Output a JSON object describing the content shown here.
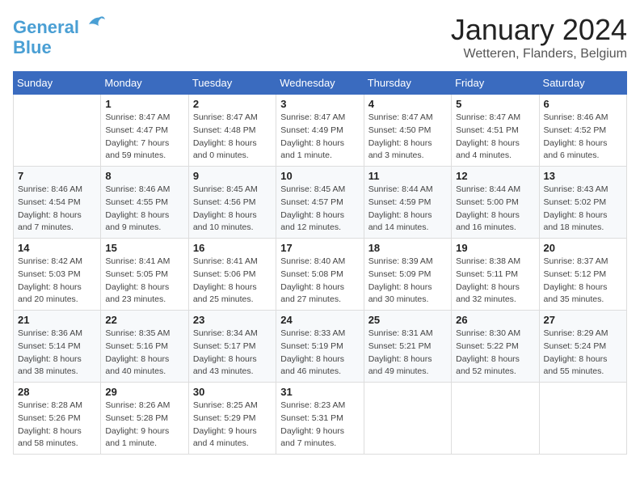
{
  "logo": {
    "line1": "General",
    "line2": "Blue"
  },
  "header": {
    "month": "January 2024",
    "location": "Wetteren, Flanders, Belgium"
  },
  "weekdays": [
    "Sunday",
    "Monday",
    "Tuesday",
    "Wednesday",
    "Thursday",
    "Friday",
    "Saturday"
  ],
  "weeks": [
    [
      {
        "day": "",
        "details": []
      },
      {
        "day": "1",
        "details": [
          "Sunrise: 8:47 AM",
          "Sunset: 4:47 PM",
          "Daylight: 7 hours",
          "and 59 minutes."
        ]
      },
      {
        "day": "2",
        "details": [
          "Sunrise: 8:47 AM",
          "Sunset: 4:48 PM",
          "Daylight: 8 hours",
          "and 0 minutes."
        ]
      },
      {
        "day": "3",
        "details": [
          "Sunrise: 8:47 AM",
          "Sunset: 4:49 PM",
          "Daylight: 8 hours",
          "and 1 minute."
        ]
      },
      {
        "day": "4",
        "details": [
          "Sunrise: 8:47 AM",
          "Sunset: 4:50 PM",
          "Daylight: 8 hours",
          "and 3 minutes."
        ]
      },
      {
        "day": "5",
        "details": [
          "Sunrise: 8:47 AM",
          "Sunset: 4:51 PM",
          "Daylight: 8 hours",
          "and 4 minutes."
        ]
      },
      {
        "day": "6",
        "details": [
          "Sunrise: 8:46 AM",
          "Sunset: 4:52 PM",
          "Daylight: 8 hours",
          "and 6 minutes."
        ]
      }
    ],
    [
      {
        "day": "7",
        "details": [
          "Sunrise: 8:46 AM",
          "Sunset: 4:54 PM",
          "Daylight: 8 hours",
          "and 7 minutes."
        ]
      },
      {
        "day": "8",
        "details": [
          "Sunrise: 8:46 AM",
          "Sunset: 4:55 PM",
          "Daylight: 8 hours",
          "and 9 minutes."
        ]
      },
      {
        "day": "9",
        "details": [
          "Sunrise: 8:45 AM",
          "Sunset: 4:56 PM",
          "Daylight: 8 hours",
          "and 10 minutes."
        ]
      },
      {
        "day": "10",
        "details": [
          "Sunrise: 8:45 AM",
          "Sunset: 4:57 PM",
          "Daylight: 8 hours",
          "and 12 minutes."
        ]
      },
      {
        "day": "11",
        "details": [
          "Sunrise: 8:44 AM",
          "Sunset: 4:59 PM",
          "Daylight: 8 hours",
          "and 14 minutes."
        ]
      },
      {
        "day": "12",
        "details": [
          "Sunrise: 8:44 AM",
          "Sunset: 5:00 PM",
          "Daylight: 8 hours",
          "and 16 minutes."
        ]
      },
      {
        "day": "13",
        "details": [
          "Sunrise: 8:43 AM",
          "Sunset: 5:02 PM",
          "Daylight: 8 hours",
          "and 18 minutes."
        ]
      }
    ],
    [
      {
        "day": "14",
        "details": [
          "Sunrise: 8:42 AM",
          "Sunset: 5:03 PM",
          "Daylight: 8 hours",
          "and 20 minutes."
        ]
      },
      {
        "day": "15",
        "details": [
          "Sunrise: 8:41 AM",
          "Sunset: 5:05 PM",
          "Daylight: 8 hours",
          "and 23 minutes."
        ]
      },
      {
        "day": "16",
        "details": [
          "Sunrise: 8:41 AM",
          "Sunset: 5:06 PM",
          "Daylight: 8 hours",
          "and 25 minutes."
        ]
      },
      {
        "day": "17",
        "details": [
          "Sunrise: 8:40 AM",
          "Sunset: 5:08 PM",
          "Daylight: 8 hours",
          "and 27 minutes."
        ]
      },
      {
        "day": "18",
        "details": [
          "Sunrise: 8:39 AM",
          "Sunset: 5:09 PM",
          "Daylight: 8 hours",
          "and 30 minutes."
        ]
      },
      {
        "day": "19",
        "details": [
          "Sunrise: 8:38 AM",
          "Sunset: 5:11 PM",
          "Daylight: 8 hours",
          "and 32 minutes."
        ]
      },
      {
        "day": "20",
        "details": [
          "Sunrise: 8:37 AM",
          "Sunset: 5:12 PM",
          "Daylight: 8 hours",
          "and 35 minutes."
        ]
      }
    ],
    [
      {
        "day": "21",
        "details": [
          "Sunrise: 8:36 AM",
          "Sunset: 5:14 PM",
          "Daylight: 8 hours",
          "and 38 minutes."
        ]
      },
      {
        "day": "22",
        "details": [
          "Sunrise: 8:35 AM",
          "Sunset: 5:16 PM",
          "Daylight: 8 hours",
          "and 40 minutes."
        ]
      },
      {
        "day": "23",
        "details": [
          "Sunrise: 8:34 AM",
          "Sunset: 5:17 PM",
          "Daylight: 8 hours",
          "and 43 minutes."
        ]
      },
      {
        "day": "24",
        "details": [
          "Sunrise: 8:33 AM",
          "Sunset: 5:19 PM",
          "Daylight: 8 hours",
          "and 46 minutes."
        ]
      },
      {
        "day": "25",
        "details": [
          "Sunrise: 8:31 AM",
          "Sunset: 5:21 PM",
          "Daylight: 8 hours",
          "and 49 minutes."
        ]
      },
      {
        "day": "26",
        "details": [
          "Sunrise: 8:30 AM",
          "Sunset: 5:22 PM",
          "Daylight: 8 hours",
          "and 52 minutes."
        ]
      },
      {
        "day": "27",
        "details": [
          "Sunrise: 8:29 AM",
          "Sunset: 5:24 PM",
          "Daylight: 8 hours",
          "and 55 minutes."
        ]
      }
    ],
    [
      {
        "day": "28",
        "details": [
          "Sunrise: 8:28 AM",
          "Sunset: 5:26 PM",
          "Daylight: 8 hours",
          "and 58 minutes."
        ]
      },
      {
        "day": "29",
        "details": [
          "Sunrise: 8:26 AM",
          "Sunset: 5:28 PM",
          "Daylight: 9 hours",
          "and 1 minute."
        ]
      },
      {
        "day": "30",
        "details": [
          "Sunrise: 8:25 AM",
          "Sunset: 5:29 PM",
          "Daylight: 9 hours",
          "and 4 minutes."
        ]
      },
      {
        "day": "31",
        "details": [
          "Sunrise: 8:23 AM",
          "Sunset: 5:31 PM",
          "Daylight: 9 hours",
          "and 7 minutes."
        ]
      },
      {
        "day": "",
        "details": []
      },
      {
        "day": "",
        "details": []
      },
      {
        "day": "",
        "details": []
      }
    ]
  ]
}
